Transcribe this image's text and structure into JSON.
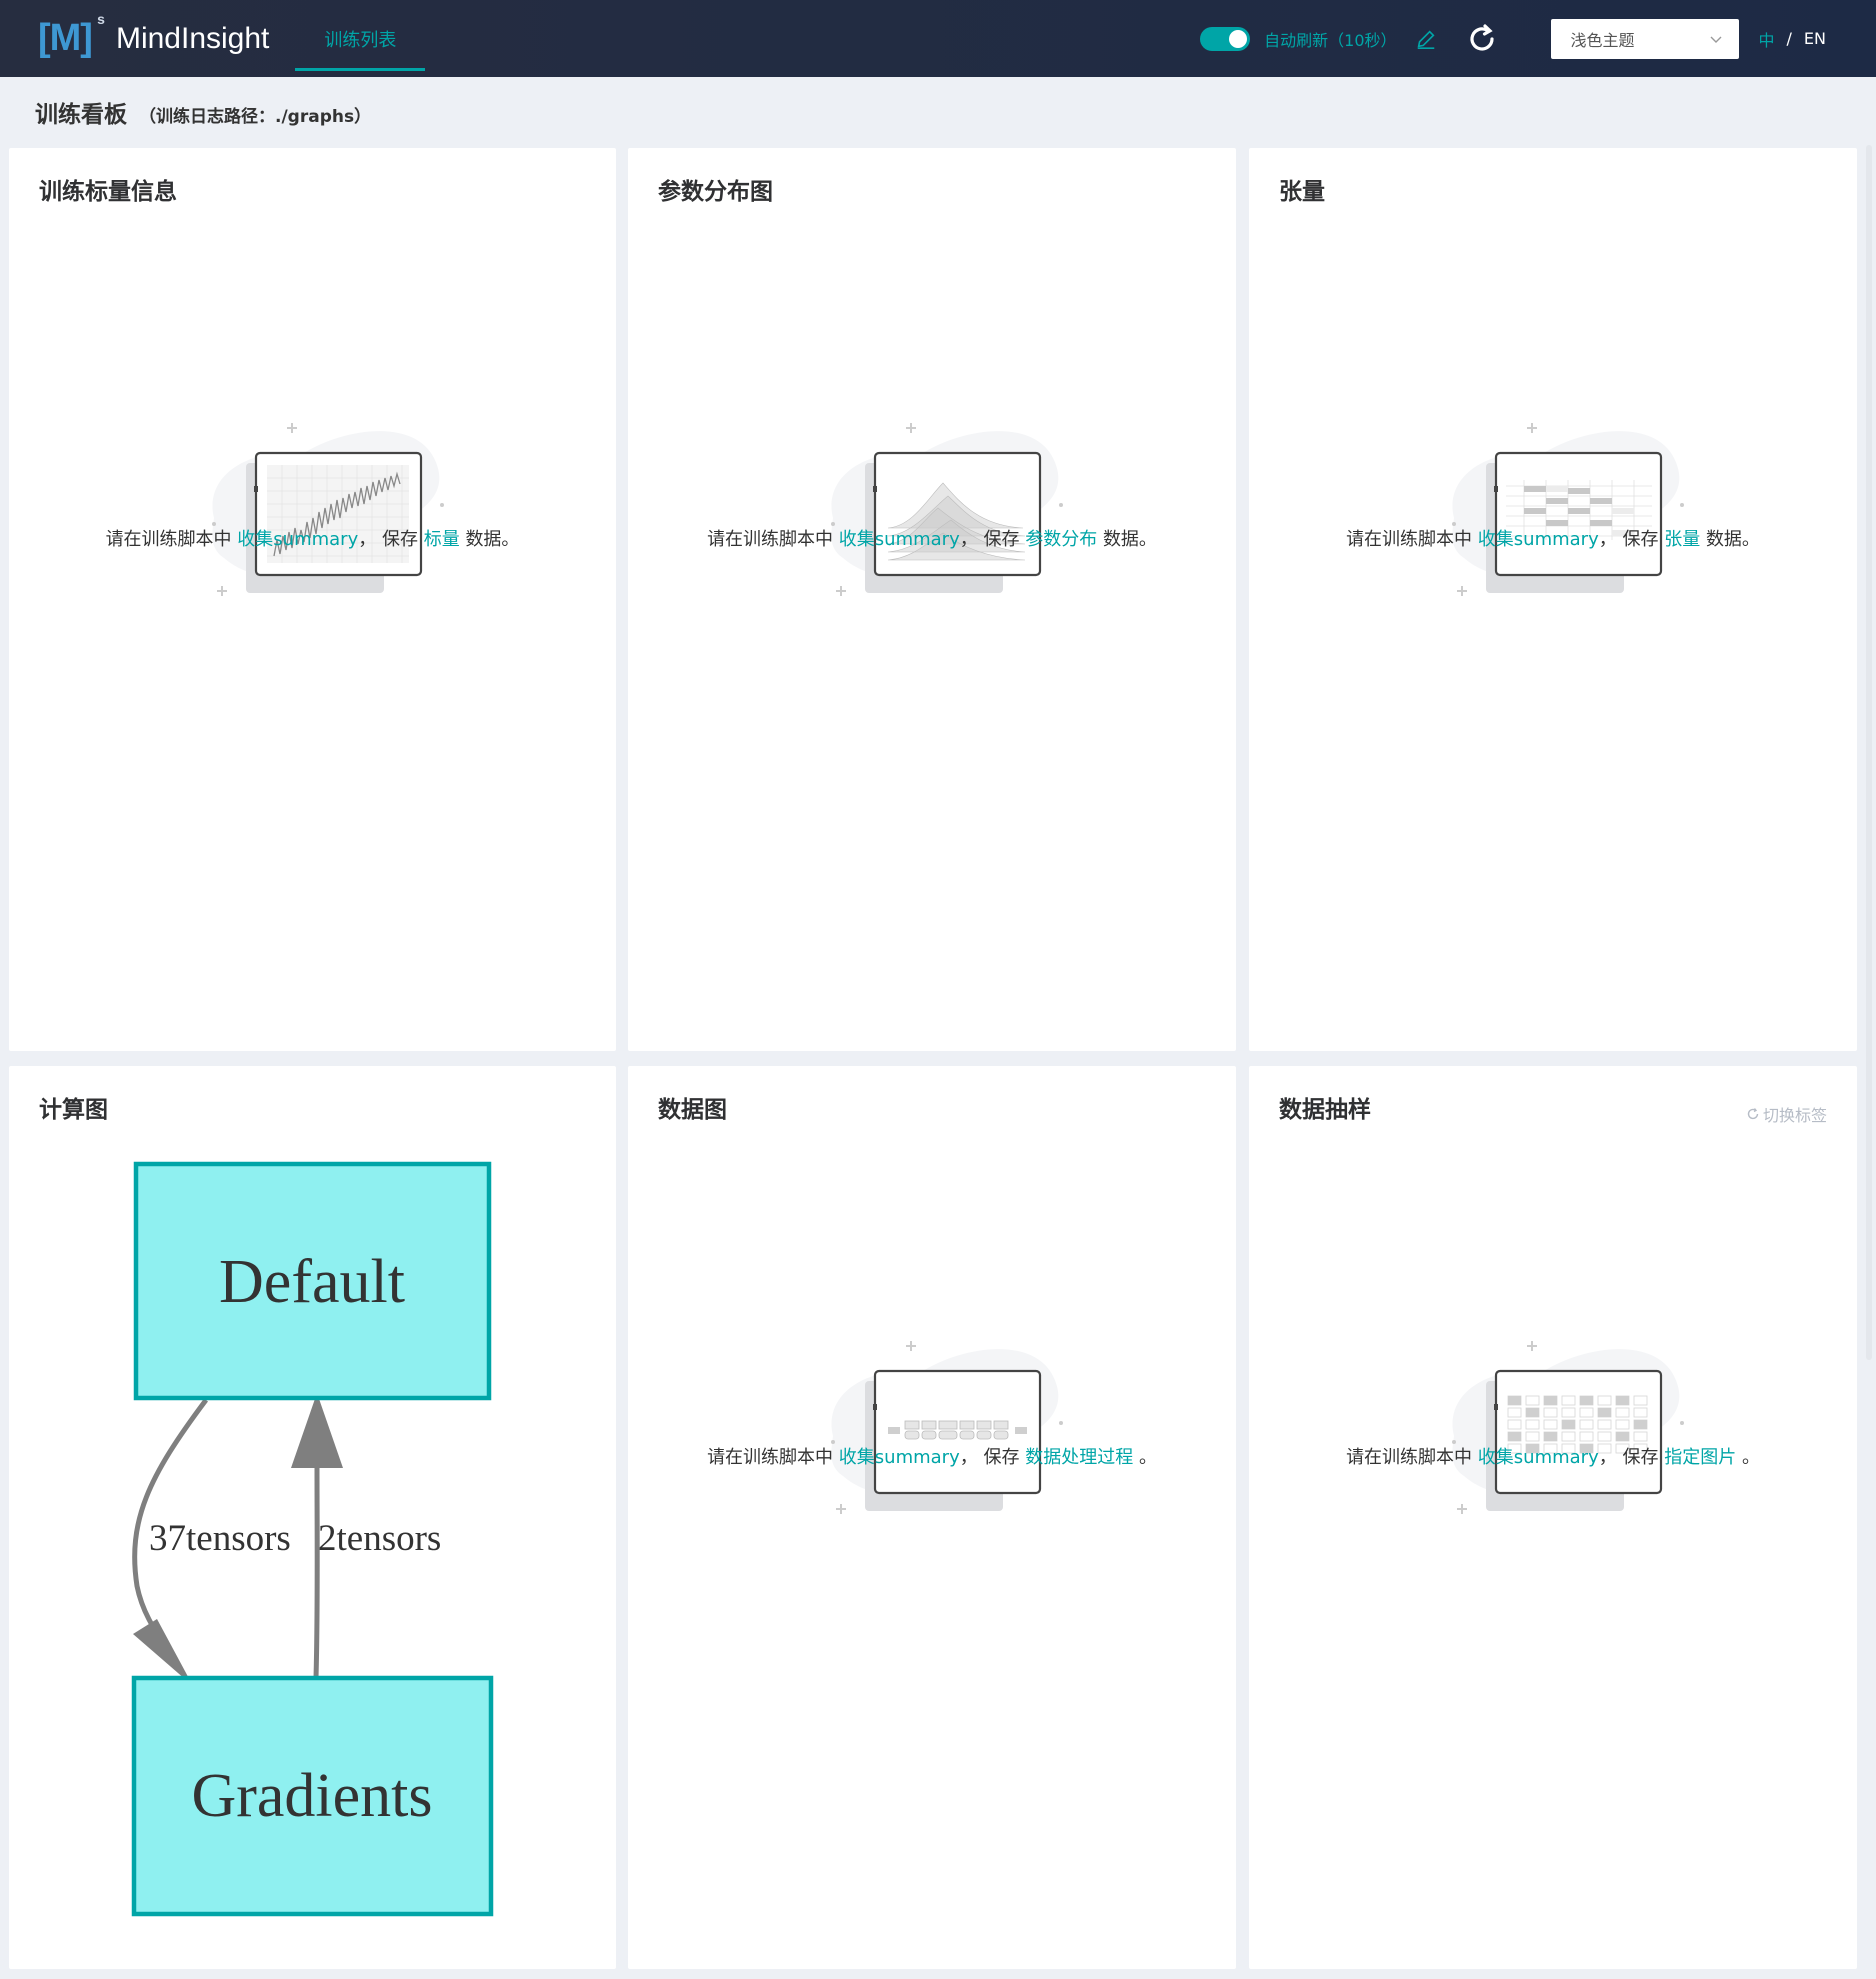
{
  "app": {
    "logo_mark": "[M]",
    "logo_sup": "s",
    "name": "MindInsight",
    "nav_tab": "训练列表"
  },
  "toolbar": {
    "auto_refresh_label": "自动刷新（10秒）",
    "auto_refresh_on": true,
    "theme_value": "浅色主题",
    "lang_zh": "中",
    "lang_sep": "/",
    "lang_en": "EN"
  },
  "header": {
    "title": "训练看板",
    "path": "（训练日志路径：./graphs）"
  },
  "common": {
    "hint_prefix": "请在训练脚本中",
    "collect": "收集summary",
    "comma": "，",
    "save": "保存",
    "suffix_data": "数据。",
    "suffix_period": "。"
  },
  "cards": {
    "scalar": {
      "title": "训练标量信息",
      "link": "标量"
    },
    "histogram": {
      "title": "参数分布图",
      "link": "参数分布"
    },
    "tensor": {
      "title": "张量",
      "link": "张量"
    },
    "graph": {
      "title": "计算图"
    },
    "datagraph": {
      "title": "数据图",
      "link": "数据处理过程"
    },
    "sampling": {
      "title": "数据抽样",
      "link": "指定图片",
      "switch_tag": "切换标签"
    }
  },
  "graph": {
    "nodes": [
      "Default",
      "Gradients"
    ],
    "edges": [
      {
        "from": "Default",
        "to": "Gradients",
        "label": "37tensors"
      },
      {
        "from": "Gradients",
        "to": "Default",
        "label": "2tensors"
      }
    ],
    "node_fill": "#8ff0f0",
    "node_stroke": "#00a5a7"
  },
  "colors": {
    "accent": "#00a5a7",
    "topbar": "#1d2a45"
  }
}
